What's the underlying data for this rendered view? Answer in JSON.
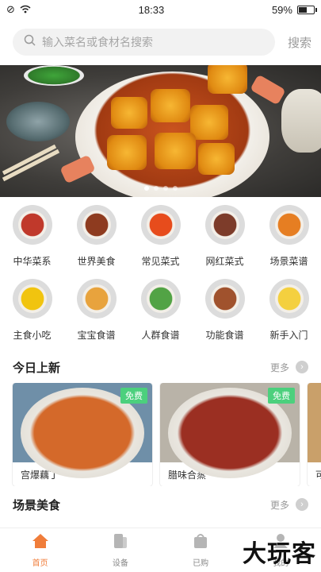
{
  "status_bar": {
    "time": "18:33",
    "battery": "59%",
    "battery_level": 0.59
  },
  "search": {
    "placeholder": "输入菜名或食材名搜索",
    "button_label": "搜索"
  },
  "banner": {
    "slides": 4,
    "active_slide": 0
  },
  "categories": [
    {
      "label": "中华菜系",
      "icon": "chinese-cuisine-icon",
      "color": "#c0392b"
    },
    {
      "label": "世界美食",
      "icon": "world-food-icon",
      "color": "#8e3b1f"
    },
    {
      "label": "常见菜式",
      "icon": "common-dish-icon",
      "color": "#e74c1c"
    },
    {
      "label": "网红菜式",
      "icon": "trending-dish-icon",
      "color": "#7d3c2a"
    },
    {
      "label": "场景菜谱",
      "icon": "scene-recipe-icon",
      "color": "#e67e22"
    },
    {
      "label": "主食小吃",
      "icon": "staple-snack-icon",
      "color": "#f1c40f"
    },
    {
      "label": "宝宝食谱",
      "icon": "baby-recipe-icon",
      "color": "#e8a33d"
    },
    {
      "label": "人群食谱",
      "icon": "group-recipe-icon",
      "color": "#52a345"
    },
    {
      "label": "功能食谱",
      "icon": "function-recipe-icon",
      "color": "#a0522d"
    },
    {
      "label": "新手入门",
      "icon": "beginner-icon",
      "color": "#f4d03f"
    }
  ],
  "today_new": {
    "title": "今日上新",
    "more_label": "更多",
    "items": [
      {
        "name": "宫爆藕丁",
        "badge": "免费",
        "color": "#d4692a"
      },
      {
        "name": "腊味合蒸",
        "badge": "免费",
        "color": "#9b2f22"
      }
    ],
    "partial_item": "可"
  },
  "scene_food": {
    "title": "场景美食",
    "more_label": "更多"
  },
  "tabbar": {
    "items": [
      {
        "label": "首页",
        "icon": "home-icon",
        "active": true
      },
      {
        "label": "设备",
        "icon": "device-icon",
        "active": false
      },
      {
        "label": "已购",
        "icon": "purchased-icon",
        "active": false
      },
      {
        "label": "我的",
        "icon": "profile-icon",
        "active": false
      }
    ]
  },
  "watermark": "大玩客",
  "colors": {
    "accent": "#f07d3a",
    "badge": "#4cd07d"
  }
}
